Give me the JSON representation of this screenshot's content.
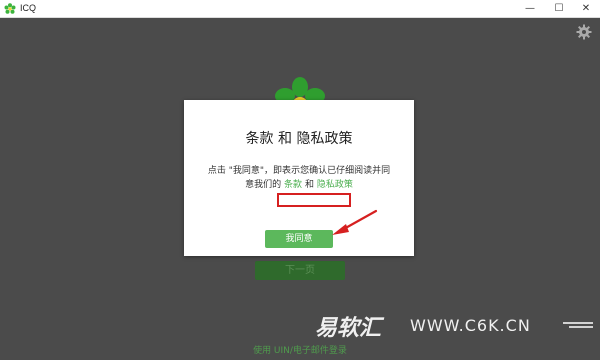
{
  "window": {
    "title": "ICQ",
    "minimize_glyph": "—",
    "maximize_glyph": "☐",
    "close_glyph": "✕"
  },
  "icons": {
    "app": "icq-flower-icon",
    "settings": "gear-icon",
    "logo": "icq-flower-logo-icon"
  },
  "background": {
    "next_button_label": "下一页",
    "alt_login_link": "使用 UIN/电子邮件登录"
  },
  "dialog": {
    "title": "条款 和 隐私政策",
    "body_line1": "点击 \"我同意\"，即表示您确认已仔细阅读并同",
    "body_line2_prefix": "意我们的",
    "terms_link": "条款",
    "and_word": "和",
    "privacy_link": "隐私政策",
    "agree_button": "我同意"
  },
  "watermark": {
    "brand": "易软汇",
    "url": "WWW.C6K.CN"
  },
  "colors": {
    "overlay": "#4b4b4b",
    "accent_green": "#5cb85c",
    "link_green": "#4caf50",
    "highlight_red": "#d62020"
  }
}
